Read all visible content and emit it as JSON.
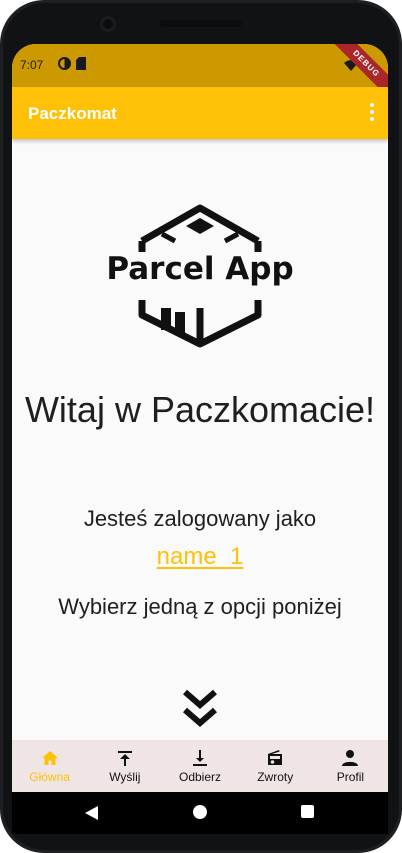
{
  "status_bar": {
    "time": "7:07",
    "debug_banner": "DEBUG"
  },
  "app_bar": {
    "title": "Paczkomat"
  },
  "logo": {
    "text": "Parcel App"
  },
  "content": {
    "welcome": "Witaj w Paczkomacie!",
    "logged_in_as": "Jesteś zalogowany jako",
    "username": "name_1",
    "choose_option": "Wybierz jedną z opcji poniżej"
  },
  "bottom_nav": {
    "items": [
      {
        "label": "Główna",
        "icon": "home-icon",
        "active": true
      },
      {
        "label": "Wyślij",
        "icon": "upload-icon",
        "active": false
      },
      {
        "label": "Odbierz",
        "icon": "download-icon",
        "active": false
      },
      {
        "label": "Zwroty",
        "icon": "radio-icon",
        "active": false
      },
      {
        "label": "Profil",
        "icon": "person-icon",
        "active": false
      }
    ]
  },
  "colors": {
    "accent": "#ffc107",
    "status_bar": "#cc9a00",
    "nav_background": "#efe5e5"
  }
}
